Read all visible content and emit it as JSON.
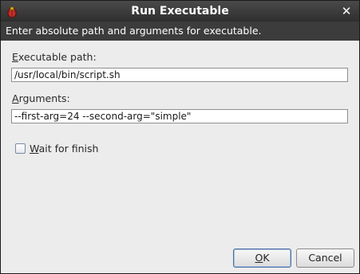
{
  "window": {
    "title": "Run Executable",
    "close_glyph": "✕",
    "app_icon": "bug-app-icon"
  },
  "banner": {
    "text": "Enter absolute path and arguments for executable."
  },
  "form": {
    "executable_path": {
      "label_mnemonic": "E",
      "label_rest": "xecutable path:",
      "value": "/usr/local/bin/script.sh"
    },
    "arguments": {
      "label_mnemonic": "A",
      "label_rest": "rguments:",
      "value": "--first-arg=24 --second-arg=\"simple\""
    },
    "wait_for_finish": {
      "label_mnemonic": "W",
      "label_rest": "ait for finish",
      "checked": false
    }
  },
  "buttons": {
    "ok": {
      "mnemonic": "O",
      "rest": "K"
    },
    "cancel": {
      "label": "Cancel"
    }
  },
  "colors": {
    "titlebar": "#3a3a3a",
    "banner": "#3c3c3c",
    "dialog_bg": "#ececec",
    "default_button_border": "#4a6ea0"
  }
}
